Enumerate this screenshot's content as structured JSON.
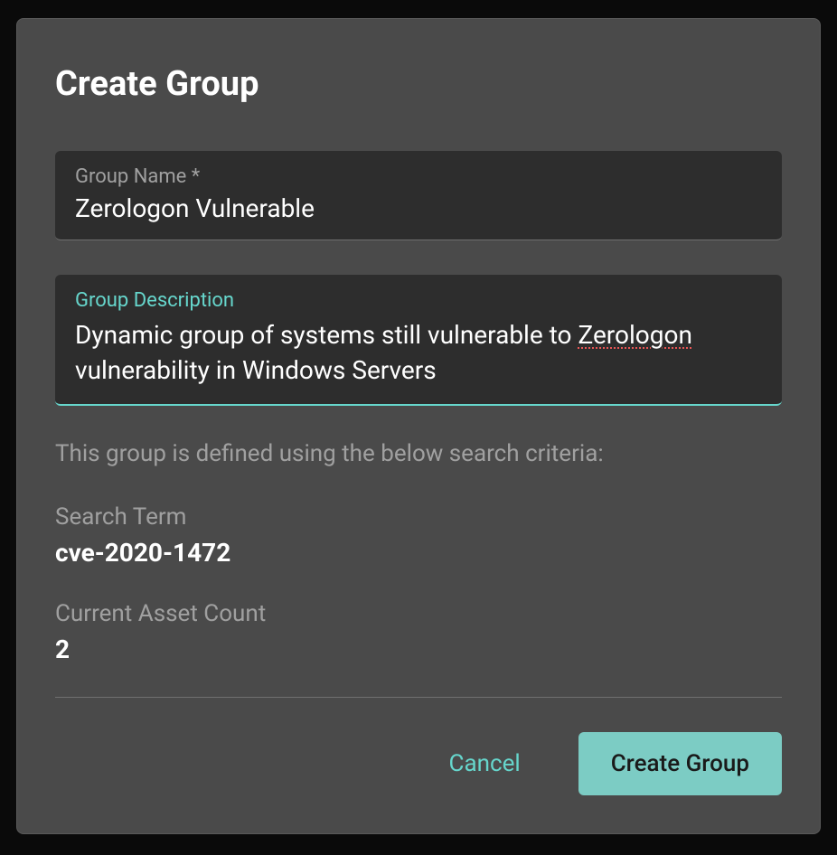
{
  "modal": {
    "title": "Create Group",
    "groupName": {
      "label": "Group Name *",
      "value": "Zerologon Vulnerable"
    },
    "groupDescription": {
      "label": "Group Description",
      "value": "Dynamic group of systems still vulnerable to Zerologon vulnerability in Windows Servers",
      "spellcheckWord": "Zerologon",
      "textBefore": "Dynamic group of systems still vulnerable to ",
      "textAfter": " vulnerability in Windows Servers"
    },
    "criteriaText": "This group is defined using the below search criteria:",
    "searchTerm": {
      "label": "Search Term",
      "value": "cve-2020-1472"
    },
    "assetCount": {
      "label": "Current Asset Count",
      "value": "2"
    },
    "buttons": {
      "cancel": "Cancel",
      "create": "Create Group"
    }
  }
}
